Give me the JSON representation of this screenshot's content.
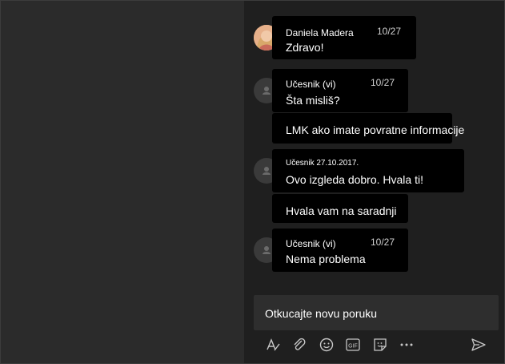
{
  "messages": [
    {
      "sender": "Daniela Madera",
      "time": "10/27",
      "text": "Zdravo!"
    },
    {
      "sender": "Učesnik (vi)",
      "time": "10/27",
      "text": "Šta misliš?"
    },
    {
      "text": "LMK ako imate povratne informacije"
    },
    {
      "sender": "Učesnik 27.10.2017.",
      "text": "Ovo izgleda dobro. Hvala ti!"
    },
    {
      "text": "Hvala vam na saradnji"
    },
    {
      "sender": "Učesnik (vi)",
      "time": "10/27",
      "text": "Nema problema"
    }
  ],
  "compose": {
    "placeholder": "Otkucajte novu poruku"
  },
  "toolbar": [
    "format-icon",
    "attach-icon",
    "emoji-icon",
    "gif-icon",
    "sticker-icon",
    "more-icon",
    "send-icon"
  ],
  "colors": {
    "left_pane": "#2b2b2b",
    "chat_bg": "#1f1f1f",
    "bubble": "#000000",
    "compose": "#2e2e2e"
  }
}
